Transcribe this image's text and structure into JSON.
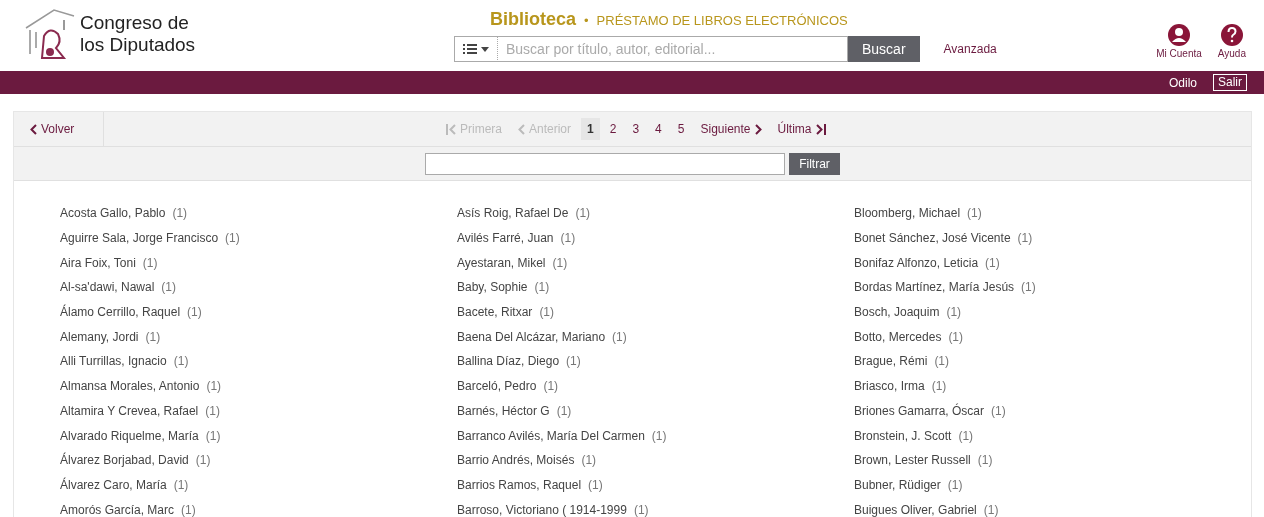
{
  "logo": {
    "line1": "Congreso de",
    "line2": "los Diputados"
  },
  "site": {
    "title": "Biblioteca",
    "separator": "•",
    "subtitle": "PRÉSTAMO DE LIBROS ELECTRÓNICOS"
  },
  "search": {
    "placeholder": "Buscar por título, autor, editorial...",
    "button": "Buscar",
    "advanced": "Avanzada"
  },
  "user_menu": [
    {
      "label": "Mi Cuenta",
      "kind": "account"
    },
    {
      "label": "Ayuda",
      "kind": "help"
    }
  ],
  "user_bar": {
    "name": "Odilo",
    "logout": "Salir"
  },
  "back": "Volver",
  "pagination": {
    "first": {
      "label": "Primera",
      "disabled": true
    },
    "prev": {
      "label": "Anterior",
      "disabled": true
    },
    "pages": [
      {
        "label": "1",
        "selected": true
      },
      {
        "label": "2",
        "selected": false
      },
      {
        "label": "3",
        "selected": false
      },
      {
        "label": "4",
        "selected": false
      },
      {
        "label": "5",
        "selected": false
      }
    ],
    "next": {
      "label": "Siguiente",
      "disabled": false
    },
    "last": {
      "label": "Última",
      "disabled": false
    }
  },
  "filter": {
    "button": "Filtrar"
  },
  "authors": [
    [
      {
        "name": "Acosta Gallo, Pablo",
        "count": "(1)"
      },
      {
        "name": "Aguirre Sala, Jorge Francisco",
        "count": "(1)"
      },
      {
        "name": "Aira Foix, Toni",
        "count": "(1)"
      },
      {
        "name": "Al-sa'dawi, Nawal",
        "count": "(1)"
      },
      {
        "name": "Álamo Cerrillo, Raquel",
        "count": "(1)"
      },
      {
        "name": "Alemany, Jordi",
        "count": "(1)"
      },
      {
        "name": "Alli Turrillas, Ignacio",
        "count": "(1)"
      },
      {
        "name": "Almansa Morales, Antonio",
        "count": "(1)"
      },
      {
        "name": "Altamira Y Crevea, Rafael",
        "count": "(1)"
      },
      {
        "name": "Alvarado Riquelme, María",
        "count": "(1)"
      },
      {
        "name": "Álvarez Borjabad, David",
        "count": "(1)"
      },
      {
        "name": "Álvarez Caro, María",
        "count": "(1)"
      },
      {
        "name": "Amorós García, Marc",
        "count": "(1)"
      }
    ],
    [
      {
        "name": "Asís Roig, Rafael De",
        "count": "(1)"
      },
      {
        "name": "Avilés Farré, Juan",
        "count": "(1)"
      },
      {
        "name": "Ayestaran, Mikel",
        "count": "(1)"
      },
      {
        "name": "Baby, Sophie",
        "count": "(1)"
      },
      {
        "name": "Bacete, Ritxar",
        "count": "(1)"
      },
      {
        "name": "Baena Del Alcázar, Mariano",
        "count": "(1)"
      },
      {
        "name": "Ballina Díaz, Diego",
        "count": "(1)"
      },
      {
        "name": "Barceló, Pedro",
        "count": "(1)"
      },
      {
        "name": "Barnés, Héctor G",
        "count": "(1)"
      },
      {
        "name": "Barranco Avilés, María Del Carmen",
        "count": "(1)"
      },
      {
        "name": "Barrio Andrés, Moisés",
        "count": "(1)"
      },
      {
        "name": "Barrios Ramos, Raquel",
        "count": "(1)"
      },
      {
        "name": "Barroso, Victoriano ( 1914-1999",
        "count": "(1)"
      }
    ],
    [
      {
        "name": "Bloomberg, Michael",
        "count": "(1)"
      },
      {
        "name": "Bonet Sánchez, José Vicente",
        "count": "(1)"
      },
      {
        "name": "Bonifaz Alfonzo, Leticia",
        "count": "(1)"
      },
      {
        "name": "Bordas Martínez, María Jesús",
        "count": "(1)"
      },
      {
        "name": "Bosch, Joaquim",
        "count": "(1)"
      },
      {
        "name": "Botto, Mercedes",
        "count": "(1)"
      },
      {
        "name": "Brague, Rémi",
        "count": "(1)"
      },
      {
        "name": "Briasco, Irma",
        "count": "(1)"
      },
      {
        "name": "Briones Gamarra, Óscar",
        "count": "(1)"
      },
      {
        "name": "Bronstein, J. Scott",
        "count": "(1)"
      },
      {
        "name": "Brown, Lester Russell",
        "count": "(1)"
      },
      {
        "name": "Bubner, Rüdiger",
        "count": "(1)"
      },
      {
        "name": "Buigues Oliver, Gabriel",
        "count": "(1)"
      }
    ]
  ]
}
